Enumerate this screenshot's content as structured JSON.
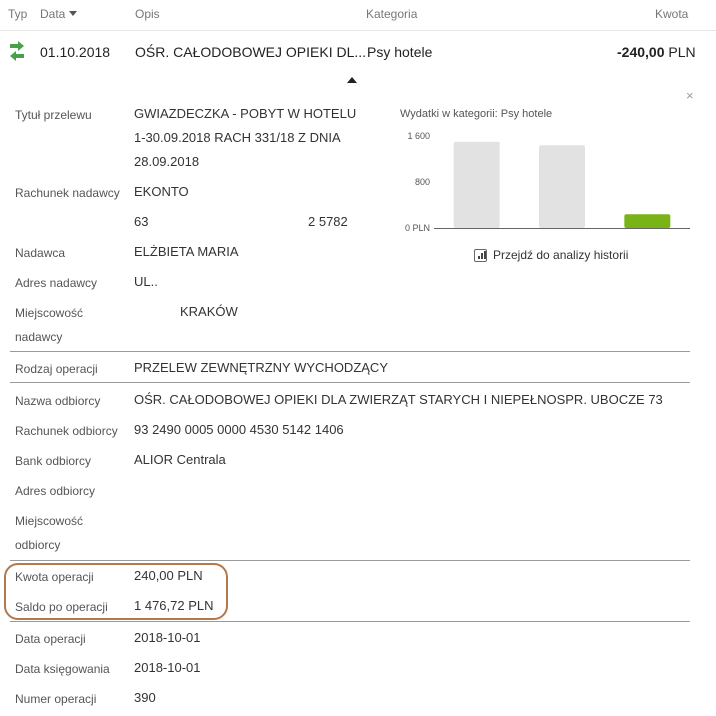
{
  "header": {
    "col_type": "Typ",
    "col_date": "Data",
    "col_desc": "Opis",
    "col_category": "Kategoria",
    "col_amount": "Kwota"
  },
  "transaction": {
    "date": "01.10.2018",
    "description": "OŚR. CAŁODOBOWEJ OPIEKI DL...",
    "category": "Psy hotele",
    "amount": "-240,00",
    "currency": "PLN",
    "icon": "transfer-icon",
    "icon_color": "#4aa04a"
  },
  "details": {
    "title_label": "Tytuł przelewu",
    "title_lines": [
      "GWIAZDECZKA - POBYT W HOTELU",
      "1-30.09.2018 RACH 331/18 Z DNIA",
      "28.09.2018"
    ],
    "sender_account_label": "Rachunek nadawcy",
    "sender_account_name": "EKONTO",
    "sender_account_part1": "63",
    "sender_account_part2": "2 5782",
    "sender_label": "Nadawca",
    "sender_value": "ELŻBIETA MARIA",
    "sender_address_label": "Adres nadawcy",
    "sender_address_value": "UL..",
    "sender_city_label_1": "Miejscowość",
    "sender_city_label_2": "nadawcy",
    "sender_city_value": "KRAKÓW",
    "operation_type_label": "Rodzaj operacji",
    "operation_type_value": "PRZELEW ZEWNĘTRZNY WYCHODZĄCY",
    "recipient_name_label": "Nazwa odbiorcy",
    "recipient_name_value": "OŚR. CAŁODOBOWEJ OPIEKI DLA ZWIERZĄT STARYCH I NIEPEŁNOSPR. UBOCZE 73",
    "recipient_account_label": "Rachunek odbiorcy",
    "recipient_account_value": "93 2490 0005 0000 4530 5142 1406",
    "recipient_bank_label": "Bank odbiorcy",
    "recipient_bank_value": "ALIOR Centrala",
    "recipient_address_label": "Adres odbiorcy",
    "recipient_city_label_1": "Miejscowość",
    "recipient_city_label_2": "odbiorcy",
    "operation_amount_label": "Kwota operacji",
    "operation_amount_value": "240,00 PLN",
    "balance_label": "Saldo po operacji",
    "balance_value": "1 476,72 PLN",
    "operation_date_label": "Data operacji",
    "operation_date_value": "2018-10-01",
    "booking_date_label": "Data księgowania",
    "booking_date_value": "2018-10-01",
    "operation_number_label": "Numer operacji",
    "operation_number_value": "390"
  },
  "close_symbol": "×",
  "category_chart": {
    "title": "Wydatki w kategorii:",
    "category": "Psy hotele",
    "link_label": "Przejdź do analizy historii"
  },
  "chart_data": {
    "type": "bar",
    "categories": [
      "",
      "",
      ""
    ],
    "values": [
      1500,
      1440,
      240
    ],
    "bar_colors": [
      "#e2e2e2",
      "#e2e2e2",
      "#7ab317"
    ],
    "ytick_labels": [
      "1 600",
      "800",
      "0 PLN"
    ],
    "yticks": [
      1600,
      800,
      0
    ],
    "ylim": [
      0,
      1600
    ],
    "grid": false
  }
}
